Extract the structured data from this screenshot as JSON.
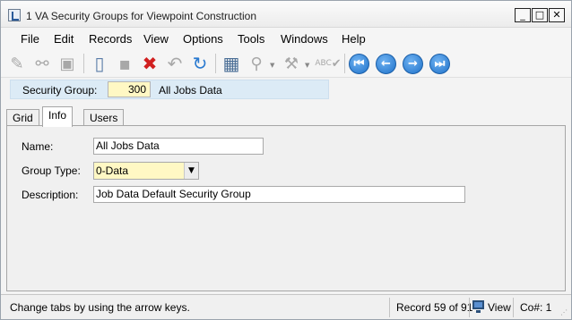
{
  "window": {
    "title": "1 VA Security Groups for Viewpoint Construction",
    "minimize_glyph": "_",
    "maximize_glyph": "□",
    "close_glyph": "✕"
  },
  "menu": [
    "File",
    "Edit",
    "Records",
    "View",
    "Options",
    "Tools",
    "Windows",
    "Help"
  ],
  "toolbar": {
    "icons": [
      "edit-icon",
      "find-icon",
      "print-icon",
      "new-record-icon",
      "save-icon",
      "delete-icon",
      "undo-icon",
      "refresh-icon",
      "calculator-icon",
      "attach-icon",
      "tools-icon",
      "spellcheck-icon"
    ],
    "nav": {
      "first": "⏮",
      "prev": "←",
      "next": "→",
      "last": "⏭"
    },
    "glyphs": {
      "edit": "✎",
      "find": "⚯",
      "print": "▣",
      "new": "▯",
      "save": "▪",
      "delete": "✖",
      "undo": "↶",
      "refresh": "↻",
      "calc": "▦",
      "attach": "⚲",
      "tools": "⚒",
      "spell": "✔",
      "spell_text": "ABC",
      "dropdown": "▼"
    }
  },
  "key": {
    "label": "Security Group:",
    "value": "300",
    "description": "All Jobs Data"
  },
  "tabs": [
    {
      "label": "Grid",
      "active": false
    },
    {
      "label": "Info",
      "active": true
    },
    {
      "label": "Users",
      "active": false
    }
  ],
  "form": {
    "name": {
      "label": "Name:",
      "value": "All Jobs Data"
    },
    "group_type": {
      "label": "Group Type:",
      "value": "0-Data",
      "button": "▼"
    },
    "description": {
      "label": "Description:",
      "value": "Job Data Default Security Group"
    }
  },
  "status": {
    "message": "Change tabs by using the arrow keys.",
    "record": "Record 59 of 91",
    "mode": "View",
    "company": "Co#: 1",
    "grip": "⋰"
  },
  "colors": {
    "key_bar": "#dcebf6",
    "required_field": "#fff8c4",
    "nav_button": "#1f72c9",
    "delete_red": "#d12020"
  }
}
